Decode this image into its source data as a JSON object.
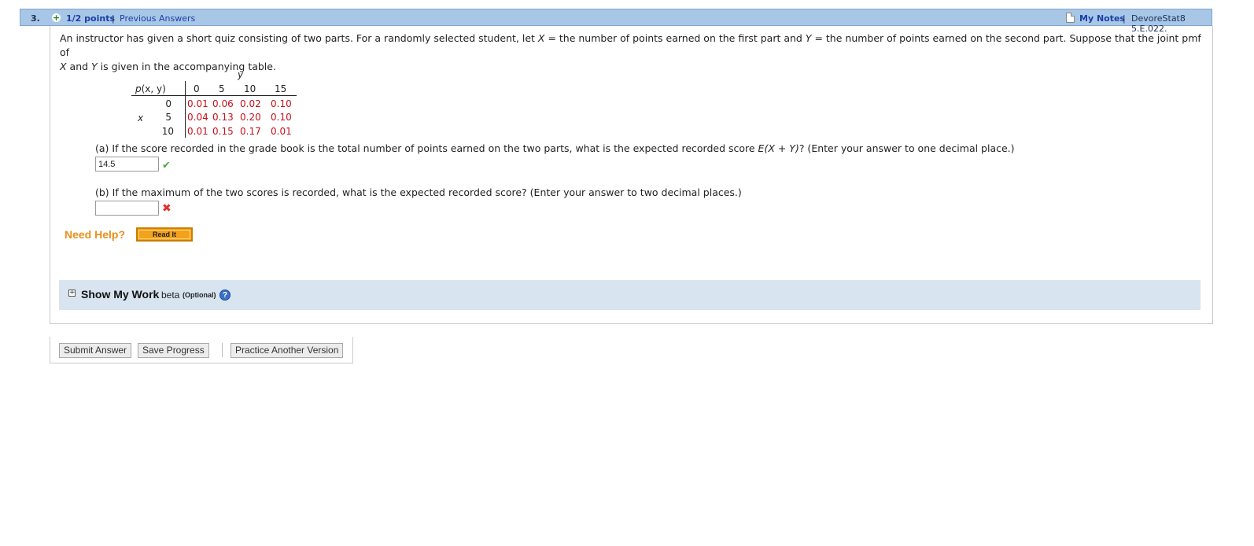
{
  "header": {
    "number": "3.",
    "points": "1/2 points",
    "sep": "|",
    "previous_answers": "Previous Answers",
    "my_notes": "My Notes",
    "reference": "DevoreStat8 5.E.022."
  },
  "question": {
    "line1_a": "An instructor has given a short quiz consisting of two parts. For a randomly selected student, let ",
    "X": "X",
    "line1_b": " = the number of points earned on the first part and ",
    "Y": "Y",
    "line1_c": " = the number of points earned on the second part. Suppose that the joint pmf of",
    "line2_a": " and ",
    "line2_b": " is given in the accompanying table."
  },
  "table": {
    "corner_p": "p",
    "corner_args": "(x, y)",
    "y_label": "y",
    "x_label": "x",
    "columns": [
      "0",
      "5",
      "10",
      "15"
    ],
    "rows": [
      {
        "x": "0",
        "values": [
          "0.01",
          "0.06",
          "0.02",
          "0.10"
        ]
      },
      {
        "x": "5",
        "values": [
          "0.04",
          "0.13",
          "0.20",
          "0.10"
        ]
      },
      {
        "x": "10",
        "values": [
          "0.01",
          "0.15",
          "0.17",
          "0.01"
        ]
      }
    ]
  },
  "part_a": {
    "text_a": "(a) If the score recorded in the grade book is the total number of points earned on the two parts, what is the expected recorded score ",
    "expr": "E(X + Y)",
    "text_b": "? (Enter your answer to one decimal place.)",
    "answer": "14.5",
    "status": "correct"
  },
  "part_b": {
    "text": "(b) If the maximum of the two scores is recorded, what is the expected recorded score? (Enter your answer to two decimal places.)",
    "answer": "",
    "status": "incorrect"
  },
  "help": {
    "label": "Need Help?",
    "read_it": "Read It"
  },
  "show_my_work": {
    "toggle": "+",
    "title": "Show My Work",
    "beta": "beta",
    "optional": "(Optional)",
    "help_symbol": "?"
  },
  "buttons": {
    "submit": "Submit Answer",
    "save": "Save Progress",
    "practice": "Practice Another Version"
  },
  "colors": {
    "header_bg": "#a8c6e6",
    "link": "#1a3fa8",
    "table_value": "#c8101a",
    "need_help": "#e8901a",
    "read_it_bg": "#f3a21c",
    "show_work_bg": "#d8e4ef"
  }
}
